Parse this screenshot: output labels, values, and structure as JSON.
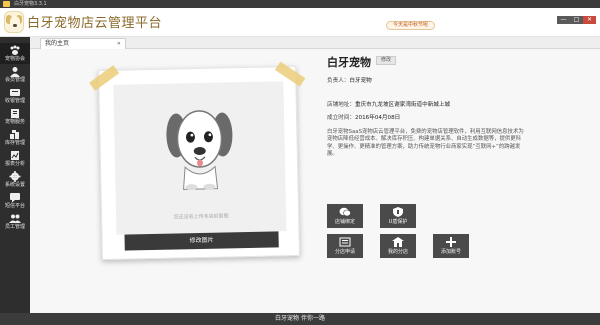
{
  "window": {
    "title": "白牙宠物3.3.1",
    "min_label": "—",
    "max_label": "□",
    "close_label": "✕"
  },
  "header": {
    "logo_text": "白牙宠物店云管理平台",
    "notice": "今天是中秋节呢"
  },
  "sidebar": {
    "items": [
      {
        "label": "宠物协会",
        "icon": "paw-icon"
      },
      {
        "label": "会员管理",
        "icon": "member-icon"
      },
      {
        "label": "收银管理",
        "icon": "cashier-icon"
      },
      {
        "label": "宠物服务",
        "icon": "service-icon"
      },
      {
        "label": "库存管理",
        "icon": "inventory-icon"
      },
      {
        "label": "报表分析",
        "icon": "report-icon"
      },
      {
        "label": "系统设置",
        "icon": "gear-icon"
      },
      {
        "label": "短信平台",
        "icon": "sms-icon"
      },
      {
        "label": "员工管理",
        "icon": "staff-icon"
      }
    ]
  },
  "tabs": {
    "active_label": "我的主页",
    "close_label": "✕"
  },
  "photo": {
    "caption": "您还没有上传本店封面图",
    "change_button": "修改图片"
  },
  "store": {
    "name": "白牙宠物",
    "edit_label": "修改",
    "owner_key": "负责人：",
    "owner_value": "白牙宠物",
    "address_key": "店铺地址：",
    "address_value": "重庆市九龙坡区谢家湾街道中新城上城",
    "founded_key": "成立时间：",
    "founded_value": "2016年04月08日",
    "description": "白牙宠物SaaS宠物店云管理平台，免费的宠物店管理软件，利用互联网信息技术为宠物店降低经营成本、解决库存积压、构建单据关系、自动生成数据等，提供更科学、更操作、更精准的管理方案，助力传统宠物行业商家实现“互联网+”的跨越发展。"
  },
  "tiles": [
    {
      "label": "店铺绑定",
      "icon": "wechat-icon"
    },
    {
      "label": "U盾保护",
      "icon": "shield-icon"
    },
    {
      "label": "分店申请",
      "icon": "branch-icon"
    },
    {
      "label": "我的分店",
      "icon": "store-icon"
    },
    {
      "label": "添加账号",
      "icon": "plus-icon"
    }
  ],
  "footer": {
    "text": "白牙宠物 伴你一路"
  },
  "colors": {
    "sidebar_bg": "#2e2e2e",
    "tile_bg": "#4a4a4a",
    "accent_tape": "#ebcd78",
    "close_red": "#c84a3c"
  }
}
